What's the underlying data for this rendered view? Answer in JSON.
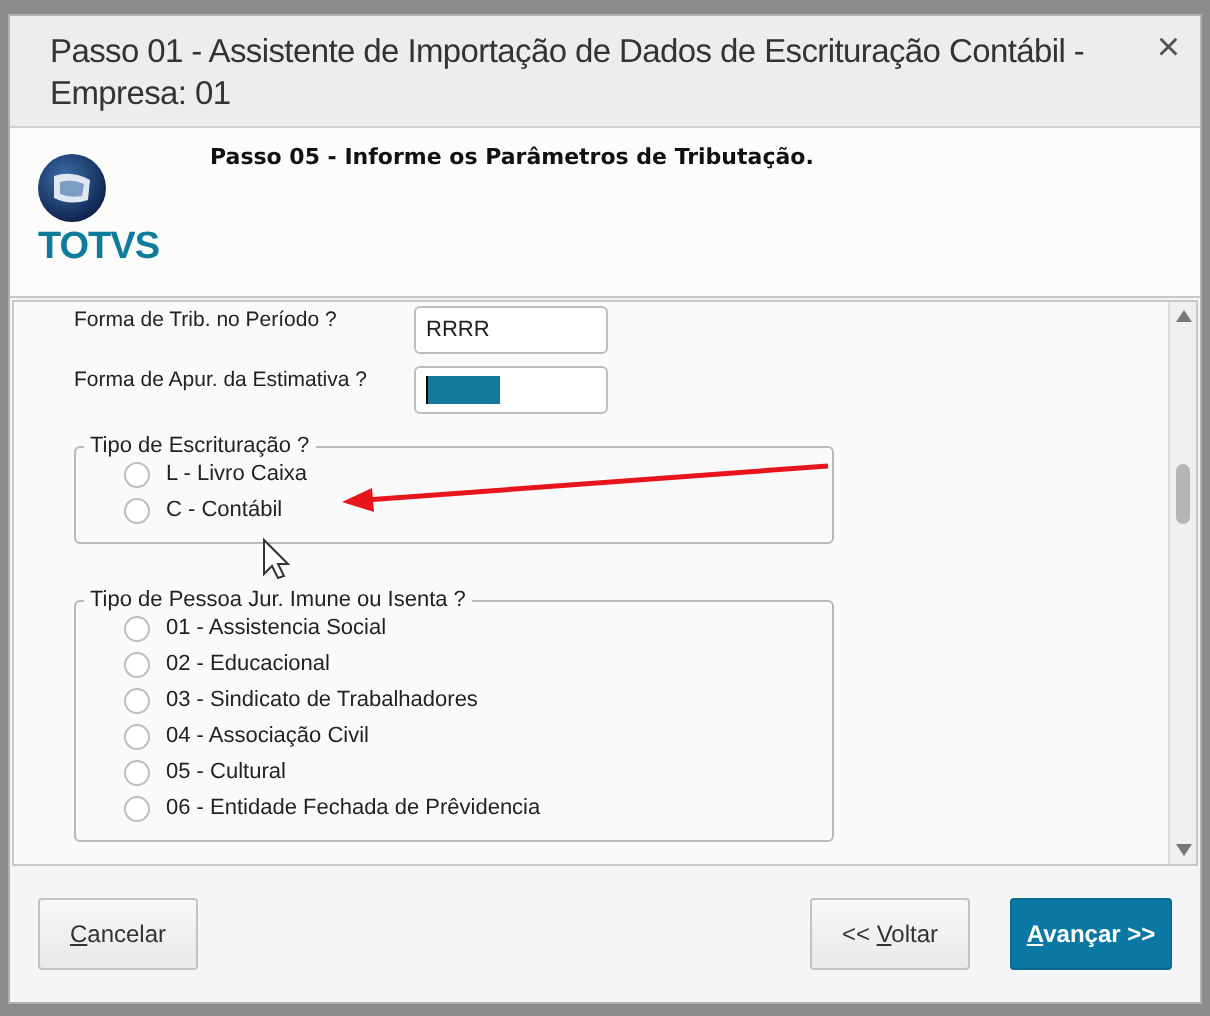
{
  "window": {
    "title": "Passo 01 - Assistente de Importação de Dados de Escrituração Contábil - Empresa: 01",
    "close": "×"
  },
  "logo": {
    "text": "TOTVS"
  },
  "step_title": "Passo 05 - Informe os Parâmetros de Tributação.",
  "fields": [
    {
      "label": "Forma de Trib. no Período ?",
      "value": "RRRR",
      "highlighted": false
    },
    {
      "label": "Forma de Apur. da Estimativa  ?",
      "highlighted": true
    }
  ],
  "groups": [
    {
      "title": "Tipo de Escrituração ?",
      "options": [
        {
          "label": "L - Livro Caixa",
          "selected": false
        },
        {
          "label": "C - Contábil",
          "selected": false
        }
      ]
    },
    {
      "title": "Tipo de Pessoa Jur. Imune ou Isenta ?",
      "options": [
        {
          "label": "01 - Assistencia Social",
          "selected": false
        },
        {
          "label": "02 - Educacional",
          "selected": false
        },
        {
          "label": "03 - Sindicato de Trabalhadores",
          "selected": false
        },
        {
          "label": "04 - Associação Civil",
          "selected": false
        },
        {
          "label": "05 - Cultural",
          "selected": false
        },
        {
          "label": "06 - Entidade Fechada de Prêvidencia",
          "selected": false
        }
      ]
    }
  ],
  "buttons": [
    {
      "mnemonic": "C",
      "after": "ancelar",
      "kind": "secondary"
    },
    {
      "before": "<< ",
      "mnemonic": "V",
      "after": "oltar",
      "kind": "secondary"
    },
    {
      "mnemonic": "A",
      "after": "vançar >>",
      "kind": "primary"
    }
  ]
}
